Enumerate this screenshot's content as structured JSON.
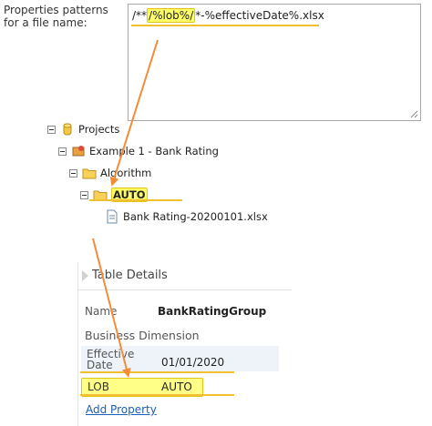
{
  "properties": {
    "label": "Properties patterns for a file name:",
    "pattern_prefix": "/**",
    "pattern_highlight": "/%lob%/",
    "pattern_suffix": "*-%effectiveDate%.xlsx"
  },
  "tree": {
    "root": "Projects",
    "project": "Example 1 - Bank Rating",
    "folder": "Algorithm",
    "subfolder": "AUTO",
    "file": "Bank Rating-20200101.xlsx"
  },
  "details": {
    "title": "Table Details",
    "name_label": "Name",
    "name_value": "BankRatingGroup",
    "section": "Business Dimension",
    "effective_label": "Effective Date",
    "effective_value": "01/01/2020",
    "lob_label": "LOB",
    "lob_value": "AUTO",
    "add_property": "Add Property"
  },
  "colors": {
    "highlight": "#ffff66",
    "arrow": "#f28c38",
    "underline": "#f0c030",
    "link": "#1a5eb8"
  }
}
